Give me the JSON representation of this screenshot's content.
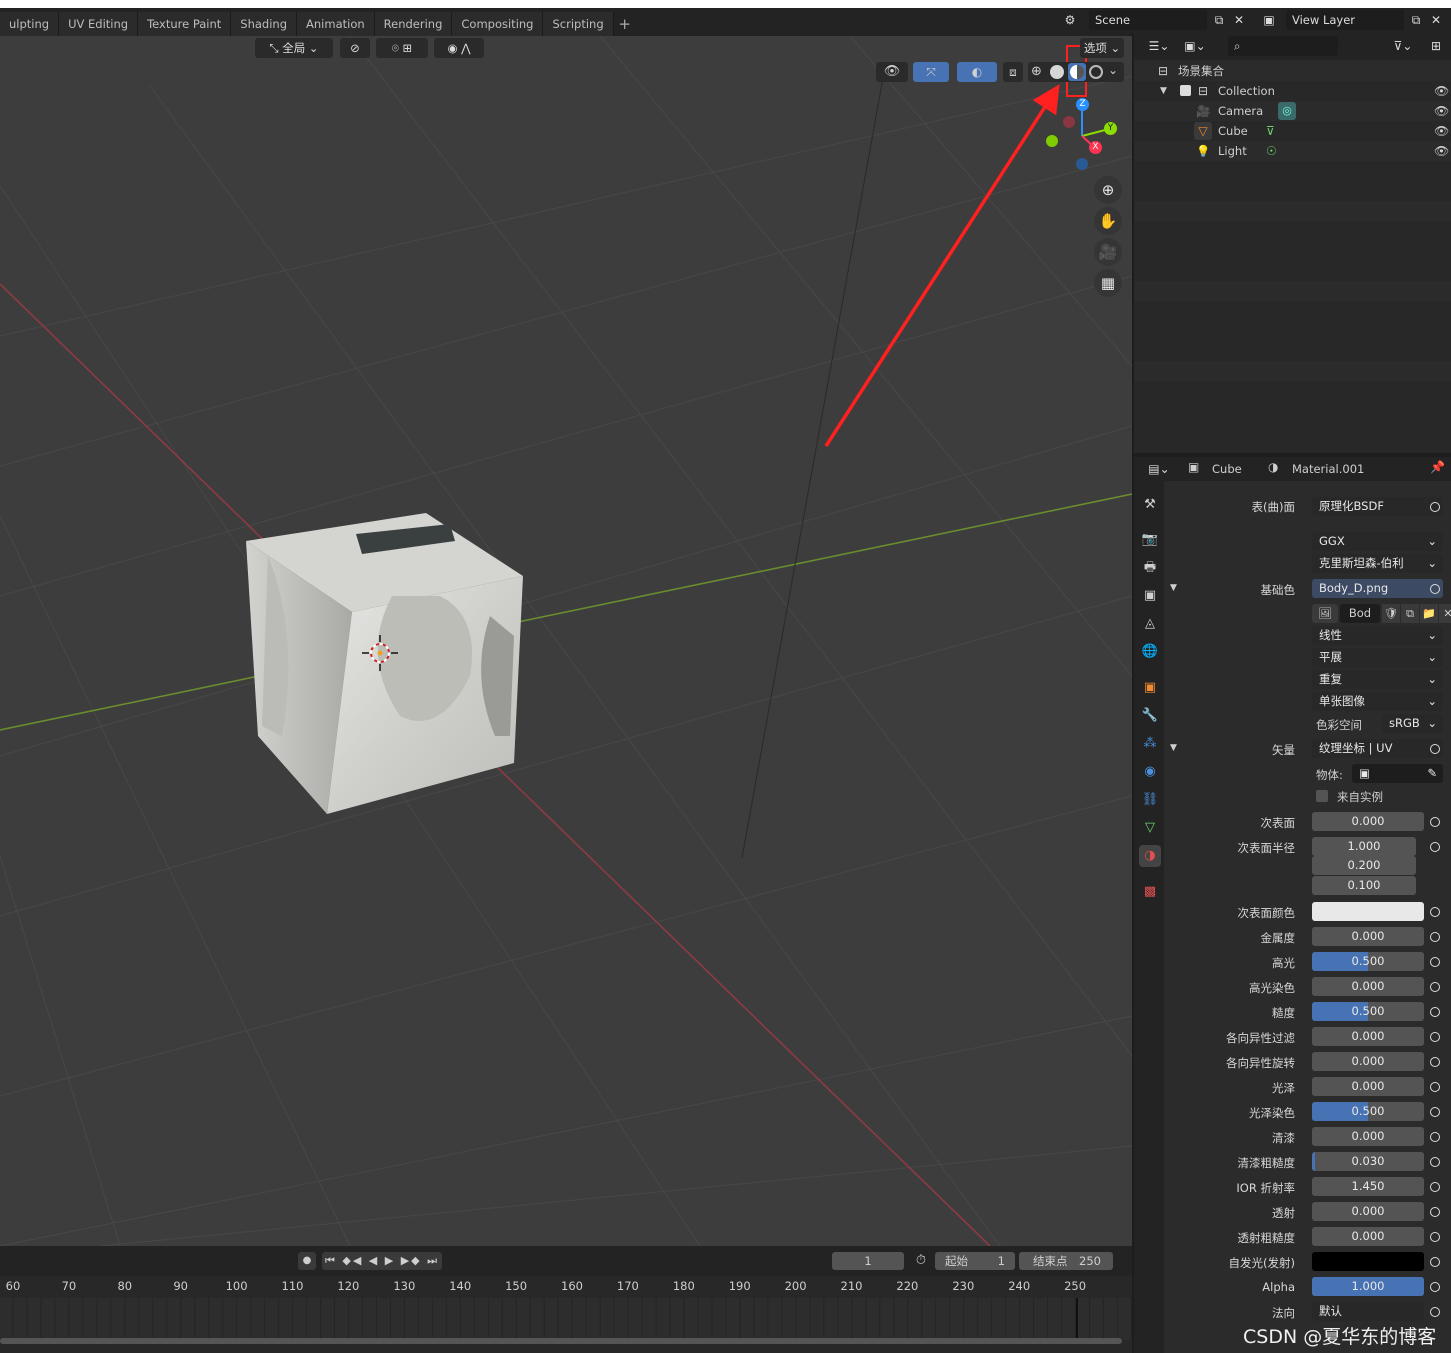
{
  "workspace_tabs": [
    "ulpting",
    "UV Editing",
    "Texture Paint",
    "Shading",
    "Animation",
    "Rendering",
    "Compositing",
    "Scripting"
  ],
  "scene": {
    "name": "Scene",
    "view_layer": "View Layer"
  },
  "viewport": {
    "transform_orientation": "全局",
    "options_label": "选项",
    "axes": {
      "x": "X",
      "y": "Y",
      "z": "Z"
    }
  },
  "outliner": {
    "root": "场景集合",
    "items": [
      {
        "label": "Collection",
        "icon": "collection-icon"
      },
      {
        "label": "Camera",
        "icon": "camera-icon"
      },
      {
        "label": "Cube",
        "icon": "mesh-icon"
      },
      {
        "label": "Light",
        "icon": "light-icon"
      }
    ]
  },
  "properties": {
    "object": "Cube",
    "material": "Material.001",
    "surface_label": "表(曲)面",
    "surface_value": "原理化BSDF",
    "distribution": "GGX",
    "subsurface_method": "克里斯坦森-伯利",
    "base_color_label": "基础色",
    "base_color_value": "Body_D.png",
    "image_name": "Bod",
    "interpolation": "线性",
    "projection": "平展",
    "extension": "重复",
    "source": "单张图像",
    "color_space_label": "色彩空间",
    "color_space": "sRGB",
    "vector_label": "矢量",
    "vector_value": "纹理坐标 | UV",
    "object_label": "物体:",
    "from_instancer": "来自实例",
    "subsurface_label": "次表面",
    "subsurface": "0.000",
    "subsurface_radius_label": "次表面半径",
    "radius": [
      "1.000",
      "0.200",
      "0.100"
    ],
    "subsurface_color_label": "次表面颜色",
    "rows": [
      {
        "label": "金属度",
        "value": "0.000",
        "fill": 0
      },
      {
        "label": "高光",
        "value": "0.500",
        "fill": 0.5
      },
      {
        "label": "高光染色",
        "value": "0.000",
        "fill": 0
      },
      {
        "label": "糙度",
        "value": "0.500",
        "fill": 0.5
      },
      {
        "label": "各向异性过滤",
        "value": "0.000",
        "fill": 0
      },
      {
        "label": "各向异性旋转",
        "value": "0.000",
        "fill": 0
      },
      {
        "label": "光泽",
        "value": "0.000",
        "fill": 0
      },
      {
        "label": "光泽染色",
        "value": "0.500",
        "fill": 0.5
      },
      {
        "label": "清漆",
        "value": "0.000",
        "fill": 0
      },
      {
        "label": "清漆粗糙度",
        "value": "0.030",
        "fill": 0.03
      },
      {
        "label": "IOR 折射率",
        "value": "1.450",
        "fill": 0
      },
      {
        "label": "透射",
        "value": "0.000",
        "fill": 0
      },
      {
        "label": "透射粗糙度",
        "value": "0.000",
        "fill": 0
      }
    ],
    "emission_label": "自发光(发射)",
    "alpha_label": "Alpha",
    "alpha": "1.000",
    "normal_label": "法向",
    "normal_value": "默认"
  },
  "timeline": {
    "current_frame": "1",
    "start_label": "起始",
    "start": "1",
    "end_label": "结束点",
    "end": "250",
    "ticks": [
      "60",
      "70",
      "80",
      "90",
      "100",
      "110",
      "120",
      "130",
      "140",
      "150",
      "160",
      "170",
      "180",
      "190",
      "200",
      "210",
      "220",
      "230",
      "240",
      "250"
    ]
  },
  "watermark": "CSDN @夏华东的博客",
  "colors": {
    "accent": "#4772b3",
    "x_axis": "#ff3352",
    "y_axis": "#8bdc00",
    "z_axis": "#2890ff",
    "annotation": "#ff2020"
  }
}
